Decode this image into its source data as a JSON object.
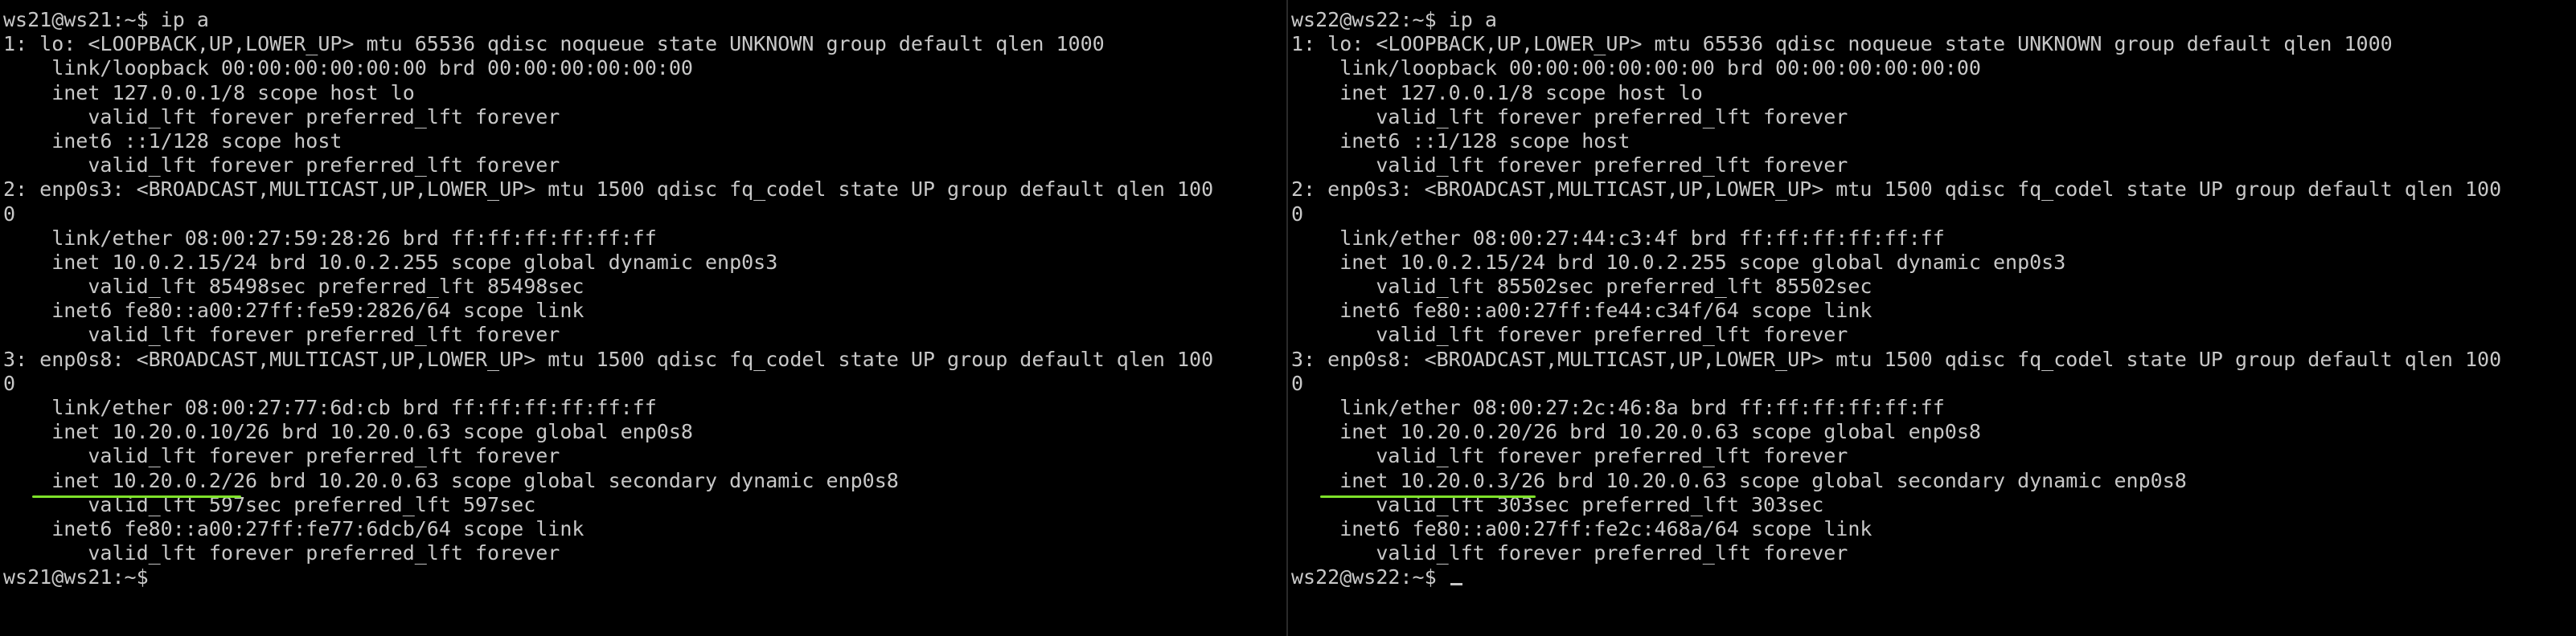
{
  "left": {
    "lines": [
      "ws21@ws21:~$ ip a",
      "1: lo: <LOOPBACK,UP,LOWER_UP> mtu 65536 qdisc noqueue state UNKNOWN group default qlen 1000",
      "    link/loopback 00:00:00:00:00:00 brd 00:00:00:00:00:00",
      "    inet 127.0.0.1/8 scope host lo",
      "       valid_lft forever preferred_lft forever",
      "    inet6 ::1/128 scope host",
      "       valid_lft forever preferred_lft forever",
      "2: enp0s3: <BROADCAST,MULTICAST,UP,LOWER_UP> mtu 1500 qdisc fq_codel state UP group default qlen 100",
      "0",
      "    link/ether 08:00:27:59:28:26 brd ff:ff:ff:ff:ff:ff",
      "    inet 10.0.2.15/24 brd 10.0.2.255 scope global dynamic enp0s3",
      "       valid_lft 85498sec preferred_lft 85498sec",
      "    inet6 fe80::a00:27ff:fe59:2826/64 scope link",
      "       valid_lft forever preferred_lft forever",
      "3: enp0s8: <BROADCAST,MULTICAST,UP,LOWER_UP> mtu 1500 qdisc fq_codel state UP group default qlen 100",
      "0",
      "    link/ether 08:00:27:77:6d:cb brd ff:ff:ff:ff:ff:ff",
      "    inet 10.20.0.10/26 brd 10.20.0.63 scope global enp0s8",
      "       valid_lft forever preferred_lft forever",
      "    inet 10.20.0.2/26 brd 10.20.0.63 scope global secondary dynamic enp0s8",
      "       valid_lft 597sec preferred_lft 597sec",
      "    inet6 fe80::a00:27ff:fe77:6dcb/64 scope link",
      "       valid_lft forever preferred_lft forever",
      "ws21@ws21:~$"
    ]
  },
  "right": {
    "lines": [
      "ws22@ws22:~$ ip a",
      "1: lo: <LOOPBACK,UP,LOWER_UP> mtu 65536 qdisc noqueue state UNKNOWN group default qlen 1000",
      "    link/loopback 00:00:00:00:00:00 brd 00:00:00:00:00:00",
      "    inet 127.0.0.1/8 scope host lo",
      "       valid_lft forever preferred_lft forever",
      "    inet6 ::1/128 scope host",
      "       valid_lft forever preferred_lft forever",
      "2: enp0s3: <BROADCAST,MULTICAST,UP,LOWER_UP> mtu 1500 qdisc fq_codel state UP group default qlen 100",
      "0",
      "    link/ether 08:00:27:44:c3:4f brd ff:ff:ff:ff:ff:ff",
      "    inet 10.0.2.15/24 brd 10.0.2.255 scope global dynamic enp0s3",
      "       valid_lft 85502sec preferred_lft 85502sec",
      "    inet6 fe80::a00:27ff:fe44:c34f/64 scope link",
      "       valid_lft forever preferred_lft forever",
      "3: enp0s8: <BROADCAST,MULTICAST,UP,LOWER_UP> mtu 1500 qdisc fq_codel state UP group default qlen 100",
      "0",
      "    link/ether 08:00:27:2c:46:8a brd ff:ff:ff:ff:ff:ff",
      "    inet 10.20.0.20/26 brd 10.20.0.63 scope global enp0s8",
      "       valid_lft forever preferred_lft forever",
      "    inet 10.20.0.3/26 brd 10.20.0.63 scope global secondary dynamic enp0s8",
      "       valid_lft 303sec preferred_lft 303sec",
      "    inet6 fe80::a00:27ff:fe2c:468a/64 scope link",
      "       valid_lft forever preferred_lft forever",
      "ws22@ws22:~$ "
    ]
  },
  "colors": {
    "background": "#000000",
    "text": "#c8c8c8",
    "highlight_underline": "#7ee12a"
  }
}
